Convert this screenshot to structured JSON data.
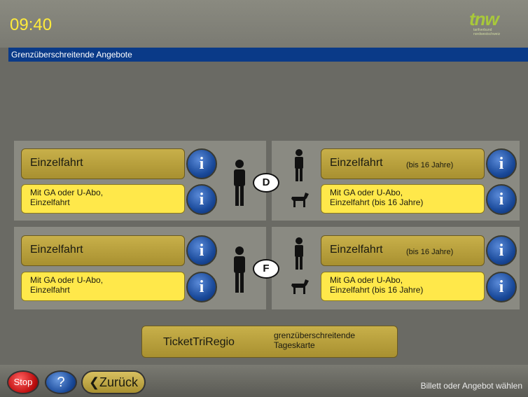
{
  "header": {
    "time": "09:40",
    "logo_text": "tnw",
    "logo_sub": "tarifverbund nordwestschweiz"
  },
  "title_bar": {
    "title": "Grenzüberschreitende Angebote"
  },
  "sections": [
    {
      "country_badge": "D",
      "adult": {
        "main_label": "Einzelfahrt",
        "secondary_label_line1": "Mit GA oder U-Abo,",
        "secondary_label_line2": "Einzelfahrt"
      },
      "child": {
        "main_label": "Einzelfahrt",
        "main_sub": "(bis 16 Jahre)",
        "secondary_label_line1": "Mit GA oder U-Abo,",
        "secondary_label_line2": "Einzelfahrt (bis 16 Jahre)"
      }
    },
    {
      "country_badge": "F",
      "adult": {
        "main_label": "Einzelfahrt",
        "secondary_label_line1": "Mit GA oder U-Abo,",
        "secondary_label_line2": "Einzelfahrt"
      },
      "child": {
        "main_label": "Einzelfahrt",
        "main_sub": "(bis 16 Jahre)",
        "secondary_label_line1": "Mit GA oder U-Abo,",
        "secondary_label_line2": "Einzelfahrt (bis 16 Jahre)"
      }
    }
  ],
  "info_label": "i",
  "bottom": {
    "ticket_label": "TicketTriRegio",
    "ticket_desc_line1": "grenzüberschreitende",
    "ticket_desc_line2": "Tageskarte"
  },
  "footer": {
    "stop_label": "Stop",
    "help_label": "?",
    "back_label": "Zurück",
    "status_text": "Billett oder Angebot wählen"
  },
  "colors": {
    "title_bar": "#0a3a88",
    "time_text": "#ffeb3b",
    "olive_button": "#b8a040",
    "yellow_button": "#ffe84a",
    "info_button": "#1a4a9a",
    "stop_button": "#c01010"
  },
  "icons": [
    "adult-person-icon",
    "child-person-icon",
    "dog-icon",
    "info-icon",
    "stop-icon",
    "help-icon",
    "back-arrow-icon"
  ]
}
